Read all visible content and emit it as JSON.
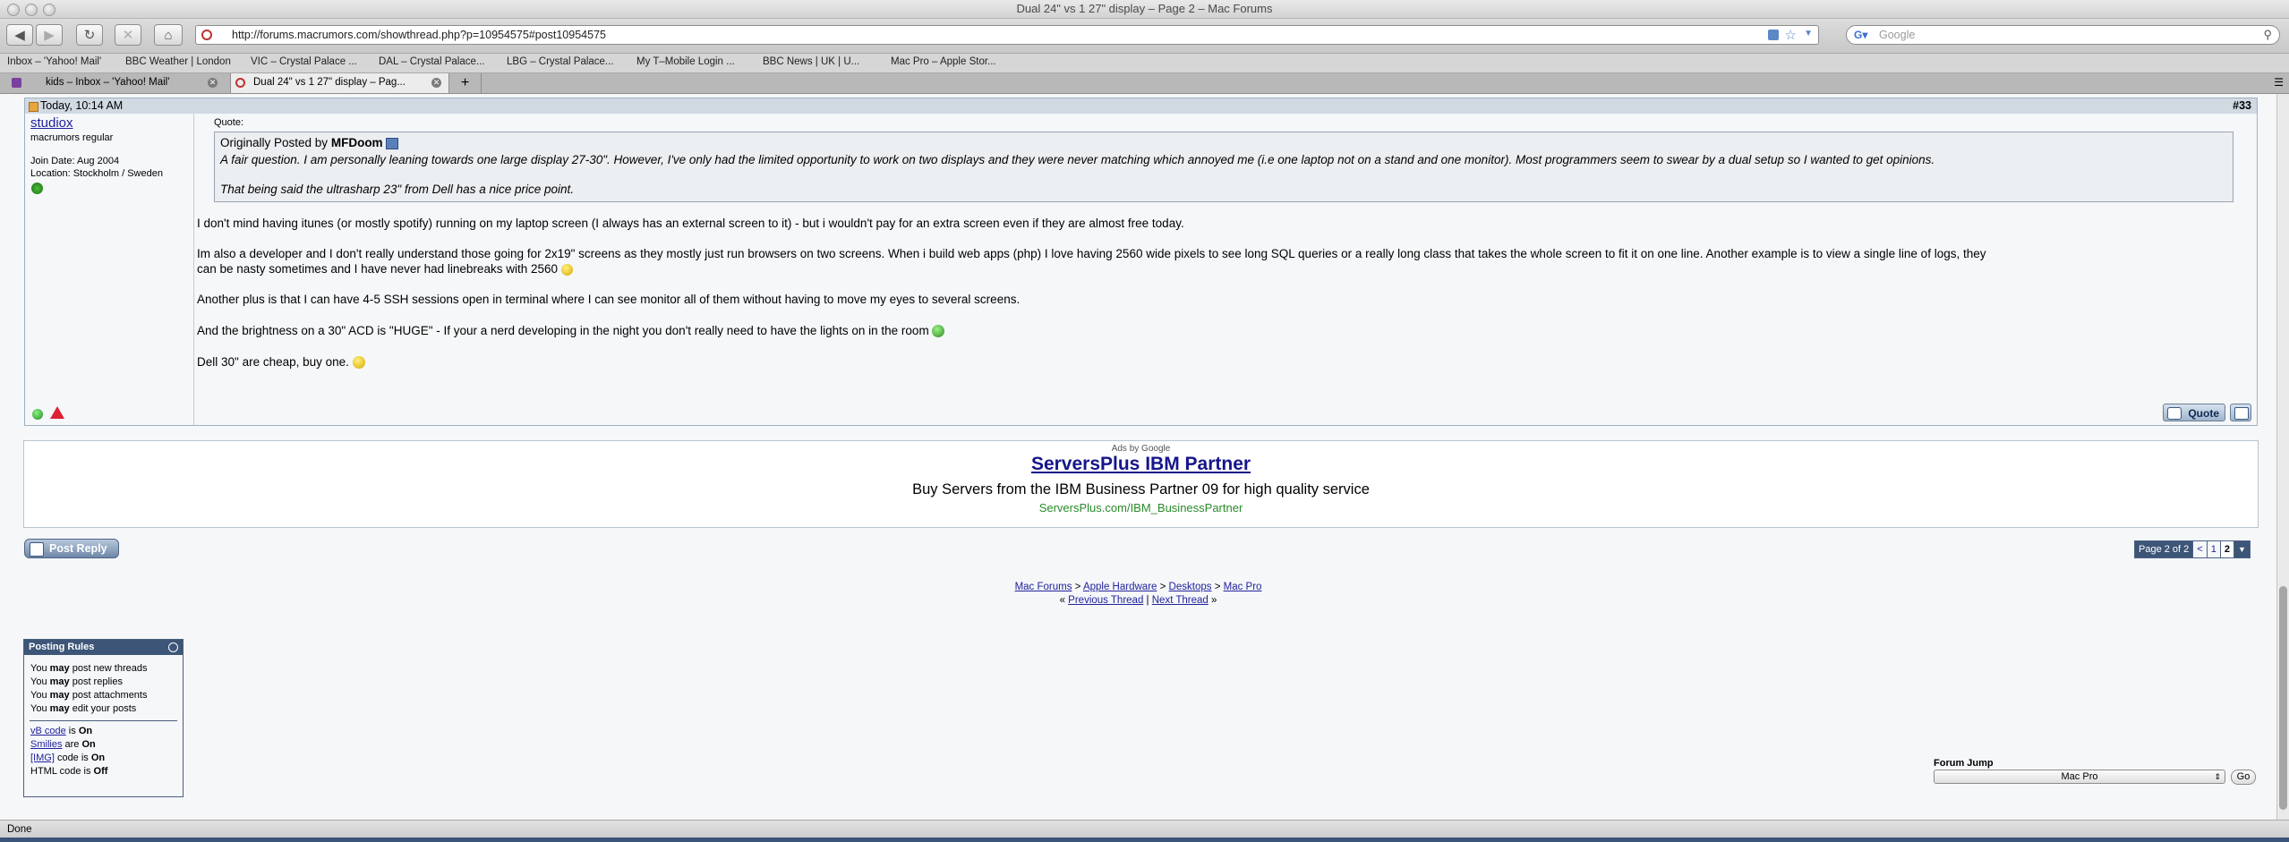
{
  "window": {
    "title": "Dual 24\" vs 1 27\" display – Page 2 – Mac Forums"
  },
  "toolbar": {
    "url": "http://forums.macrumors.com/showthread.php?p=10954575#post10954575",
    "search_placeholder": "Google"
  },
  "bookmarks": [
    "Inbox – 'Yahoo! Mail'",
    "BBC Weather | London",
    "VIC – Crystal Palace ...",
    "DAL – Crystal Palace...",
    "LBG – Crystal Palace...",
    "My T–Mobile Login ...",
    "BBC News | UK | U...",
    "Mac Pro – Apple Stor..."
  ],
  "tabs": [
    {
      "label": "kids – Inbox – 'Yahoo! Mail'"
    },
    {
      "label": "Dual 24\" vs 1 27\" display – Pag..."
    }
  ],
  "post": {
    "date": "Today, 10:14 AM",
    "number": "#33",
    "username": "studiox",
    "user_title": "macrumors regular",
    "join_date": "Join Date: Aug 2004",
    "location": "Location: Stockholm / Sweden",
    "quote_label": "Quote:",
    "quote_originally": "Originally Posted by",
    "quote_author": "MFDoom",
    "quote_line1": "A fair question. I am personally leaning towards one large display 27-30\". However, I've only had the limited opportunity to work on two displays and they were never matching which annoyed me (i.e one laptop not on a stand and one monitor). Most programmers seem to swear by a dual setup so I wanted to get opinions.",
    "quote_line2": "That being said the ultrasharp 23\" from Dell has a nice price point.",
    "p1": "I don't mind having itunes (or mostly spotify) running on my laptop screen (I always has an external screen to it) - but i wouldn't pay for an extra screen even if they are almost free today.",
    "p2a": "Im also a developer and I don't really understand those going for 2x19\" screens as they mostly just run browsers on two screens. When i build web apps (php) I love having 2560 wide pixels to see long SQL queries or a really long class that takes the whole screen to fit it on one line. Another example is to view a single line of logs, they",
    "p2b": "can be nasty sometimes and I have never had linebreaks with 2560",
    "p3": "Another plus is that I can have 4-5 SSH sessions open in terminal where I can see monitor all of them without having to move my eyes to several screens.",
    "p4": "And the brightness on a 30\" ACD is \"HUGE\" - If your a nerd developing in the night you don't really need to have the lights on in the room",
    "p5": "Dell 30\" are cheap, buy one.",
    "quote_button": "Quote"
  },
  "ad": {
    "label": "Ads by Google",
    "title": "ServersPlus IBM Partner",
    "desc": "Buy Servers from the IBM Business Partner 09 for high quality service",
    "url": "ServersPlus.com/IBM_BusinessPartner"
  },
  "nav": {
    "post_reply": "Post Reply",
    "page_of": "Page 2 of 2",
    "prev": "<",
    "page1": "1",
    "page2": "2",
    "breadcrumb": [
      "Mac Forums",
      "Apple Hardware",
      "Desktops",
      "Mac Pro"
    ],
    "sep": ">",
    "prev_thread": "Previous Thread",
    "next_thread": "Next Thread",
    "laquo": "«",
    "raquo": "»",
    "pipe": "|"
  },
  "rules": {
    "title": "Posting Rules",
    "lines": [
      {
        "pre": "You ",
        "bold": "may",
        "post": " post new threads"
      },
      {
        "pre": "You ",
        "bold": "may",
        "post": " post replies"
      },
      {
        "pre": "You ",
        "bold": "may",
        "post": " post attachments"
      },
      {
        "pre": "You ",
        "bold": "may",
        "post": " edit your posts"
      }
    ],
    "vb_code": "vB code",
    "vb_state": "On",
    "vb_is": " is ",
    "smilies": "Smilies",
    "smilies_are": " are ",
    "smilies_state": "On",
    "img": "[IMG]",
    "img_is": " code is ",
    "img_state": "On",
    "html": "HTML code is ",
    "html_state": "Off"
  },
  "forum_jump": {
    "label": "Forum Jump",
    "selected": "Mac Pro",
    "go": "Go"
  },
  "status": {
    "text": "Done"
  },
  "colors": {
    "accent": "#3d5678",
    "link": "#22229c",
    "ad_url": "#2a8a2a"
  }
}
